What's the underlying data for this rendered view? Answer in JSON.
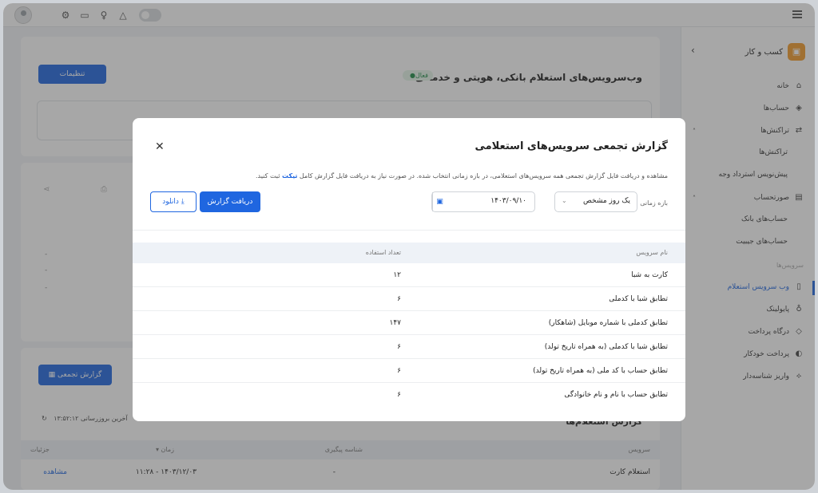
{
  "topbar": {
    "icons": [
      "user-avatar",
      "gear-icon",
      "chat-icon",
      "bulb-icon",
      "bell-icon",
      "theme-toggle",
      "menu-icon"
    ]
  },
  "sidebar": {
    "brand": "کسب و کار",
    "items": [
      {
        "label": "خانه",
        "icon": "home-icon"
      },
      {
        "label": "حساب‌ها",
        "icon": "layers-icon"
      },
      {
        "label": "تراکنش‌ها",
        "icon": "transactions-icon"
      },
      {
        "label": "تراکنش‌ها"
      },
      {
        "label": "پیش‌نویس استرداد وجه"
      },
      {
        "label": "صورتحساب",
        "icon": "invoice-icon"
      },
      {
        "label": "حساب‌های بانک"
      },
      {
        "label": "حساب‌های جیبیت"
      }
    ],
    "section_label": "سرویس‌ها",
    "services": [
      {
        "label": "وب سرویس استعلام",
        "icon": "book-icon",
        "active": true
      },
      {
        "label": "پایولینک",
        "icon": "link-icon"
      },
      {
        "label": "درگاه پرداخت",
        "icon": "gateway-icon"
      },
      {
        "label": "پرداخت خودکار",
        "icon": "auto-pay-icon"
      },
      {
        "label": "واریز شناسه‌دار",
        "icon": "deposit-icon"
      }
    ]
  },
  "main": {
    "title": "وب‌سرویس‌های استعلام بانکی، هویتی و خدماتی",
    "status_badge": "فعال",
    "settings_button": "تنظیمات",
    "aggregate_button": "گزارش تجمعی",
    "last_update": "آخرین بروزرسانی ۱۳:۵۲:۱۲",
    "reports_heading": "گزارش استعلام‌ها",
    "dash": "-",
    "columns": [
      "سرویس",
      "شناسه پیگیری",
      "زمان",
      "جزئیات"
    ],
    "row": {
      "service": "استعلام کارت",
      "tracking": "-",
      "time": "۱۴۰۳/۱۲/۰۳ - ۱۱:۲۸",
      "details": "مشاهده"
    }
  },
  "modal": {
    "title": "گزارش تجمعی سرویس‌های استعلامی",
    "desc_prefix": "مشاهده و دریافت فایل گزارش تجمعی همه سرویس‌های استعلامی، در بازه زمانی انتخاب شده. در صورت نیاز به دریافت فایل گزارش کامل",
    "desc_link": "تیکت",
    "desc_suffix": "ثبت کنید.",
    "range_label": "بازه زمانی",
    "range_value": "یک روز مشخص",
    "date_value": "۱۴۰۳/۰۹/۱۰",
    "report_button": "دریافت گزارش",
    "download_button": "دانلود",
    "table": {
      "headers": {
        "name": "نام سرویس",
        "count": "تعداد استفاده"
      },
      "rows": [
        {
          "name": "کارت به شبا",
          "count": "۱۲"
        },
        {
          "name": "تطابق شبا با کدملی",
          "count": "۶"
        },
        {
          "name": "تطابق کدملی با شماره موبایل (شاهکار)",
          "count": "۱۴۷"
        },
        {
          "name": "تطابق شبا با کدملی (به همراه تاریخ تولد)",
          "count": "۶"
        },
        {
          "name": "تطابق حساب با کد ملی (به همراه تاریخ تولد)",
          "count": "۶"
        },
        {
          "name": "تطابق حساب با نام و نام خانوادگی",
          "count": "۶"
        }
      ]
    }
  }
}
